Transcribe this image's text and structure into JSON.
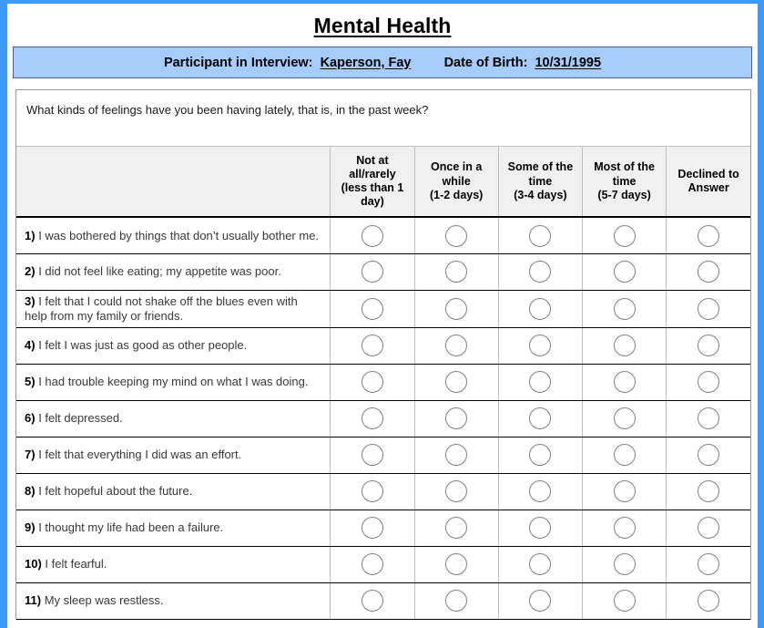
{
  "form": {
    "title": "Mental Health",
    "participant": {
      "label": "Participant in Interview:",
      "name": "Kaperson, Fay",
      "dob_label": "Date of Birth:",
      "dob": "10/31/1995"
    },
    "prompt": "What kinds of feelings have you been having lately, that is, in the past week?",
    "columns": [
      {
        "key": "question",
        "label": ""
      },
      {
        "key": "not_at_all",
        "line1": "Not at",
        "line2": "all/rarely",
        "line3": "(less than 1",
        "line4": "day)"
      },
      {
        "key": "once_in_a_while",
        "line1": "Once in a",
        "line2": "while",
        "line3": "(1-2 days)",
        "line4": ""
      },
      {
        "key": "some_of_the_time",
        "line1": "Some of the",
        "line2": "time",
        "line3": "(3-4 days)",
        "line4": ""
      },
      {
        "key": "most_of_the_time",
        "line1": "Most of the",
        "line2": "time",
        "line3": "(5-7 days)",
        "line4": ""
      },
      {
        "key": "declined",
        "line1": "Declined to",
        "line2": "Answer",
        "line3": "",
        "line4": ""
      }
    ],
    "questions": [
      {
        "num": "1)",
        "text": "I was bothered by things that don’t usually bother me."
      },
      {
        "num": "2)",
        "text": "I did not feel like eating; my appetite was poor."
      },
      {
        "num": "3)",
        "text": "I felt that I could not shake off the blues even with help from my family or friends."
      },
      {
        "num": "4)",
        "text": "I felt I was just as good as other people."
      },
      {
        "num": "5)",
        "text": "I had trouble keeping my mind on what I was doing."
      },
      {
        "num": "6)",
        "text": "I felt depressed."
      },
      {
        "num": "7)",
        "text": "I felt that everything I did was an effort."
      },
      {
        "num": "8)",
        "text": "I felt hopeful about the future."
      },
      {
        "num": "9)",
        "text": "I thought my life had been a failure."
      },
      {
        "num": "10)",
        "text": "I felt fearful."
      },
      {
        "num": "11)",
        "text": "My sleep was restless."
      }
    ],
    "colors": {
      "page_frame": "#3d9bf5",
      "banner_bg": "#a6ccfb",
      "banner_border": "#4a5fa5",
      "header_bg": "#f0f0f0",
      "text": "#000000"
    }
  }
}
